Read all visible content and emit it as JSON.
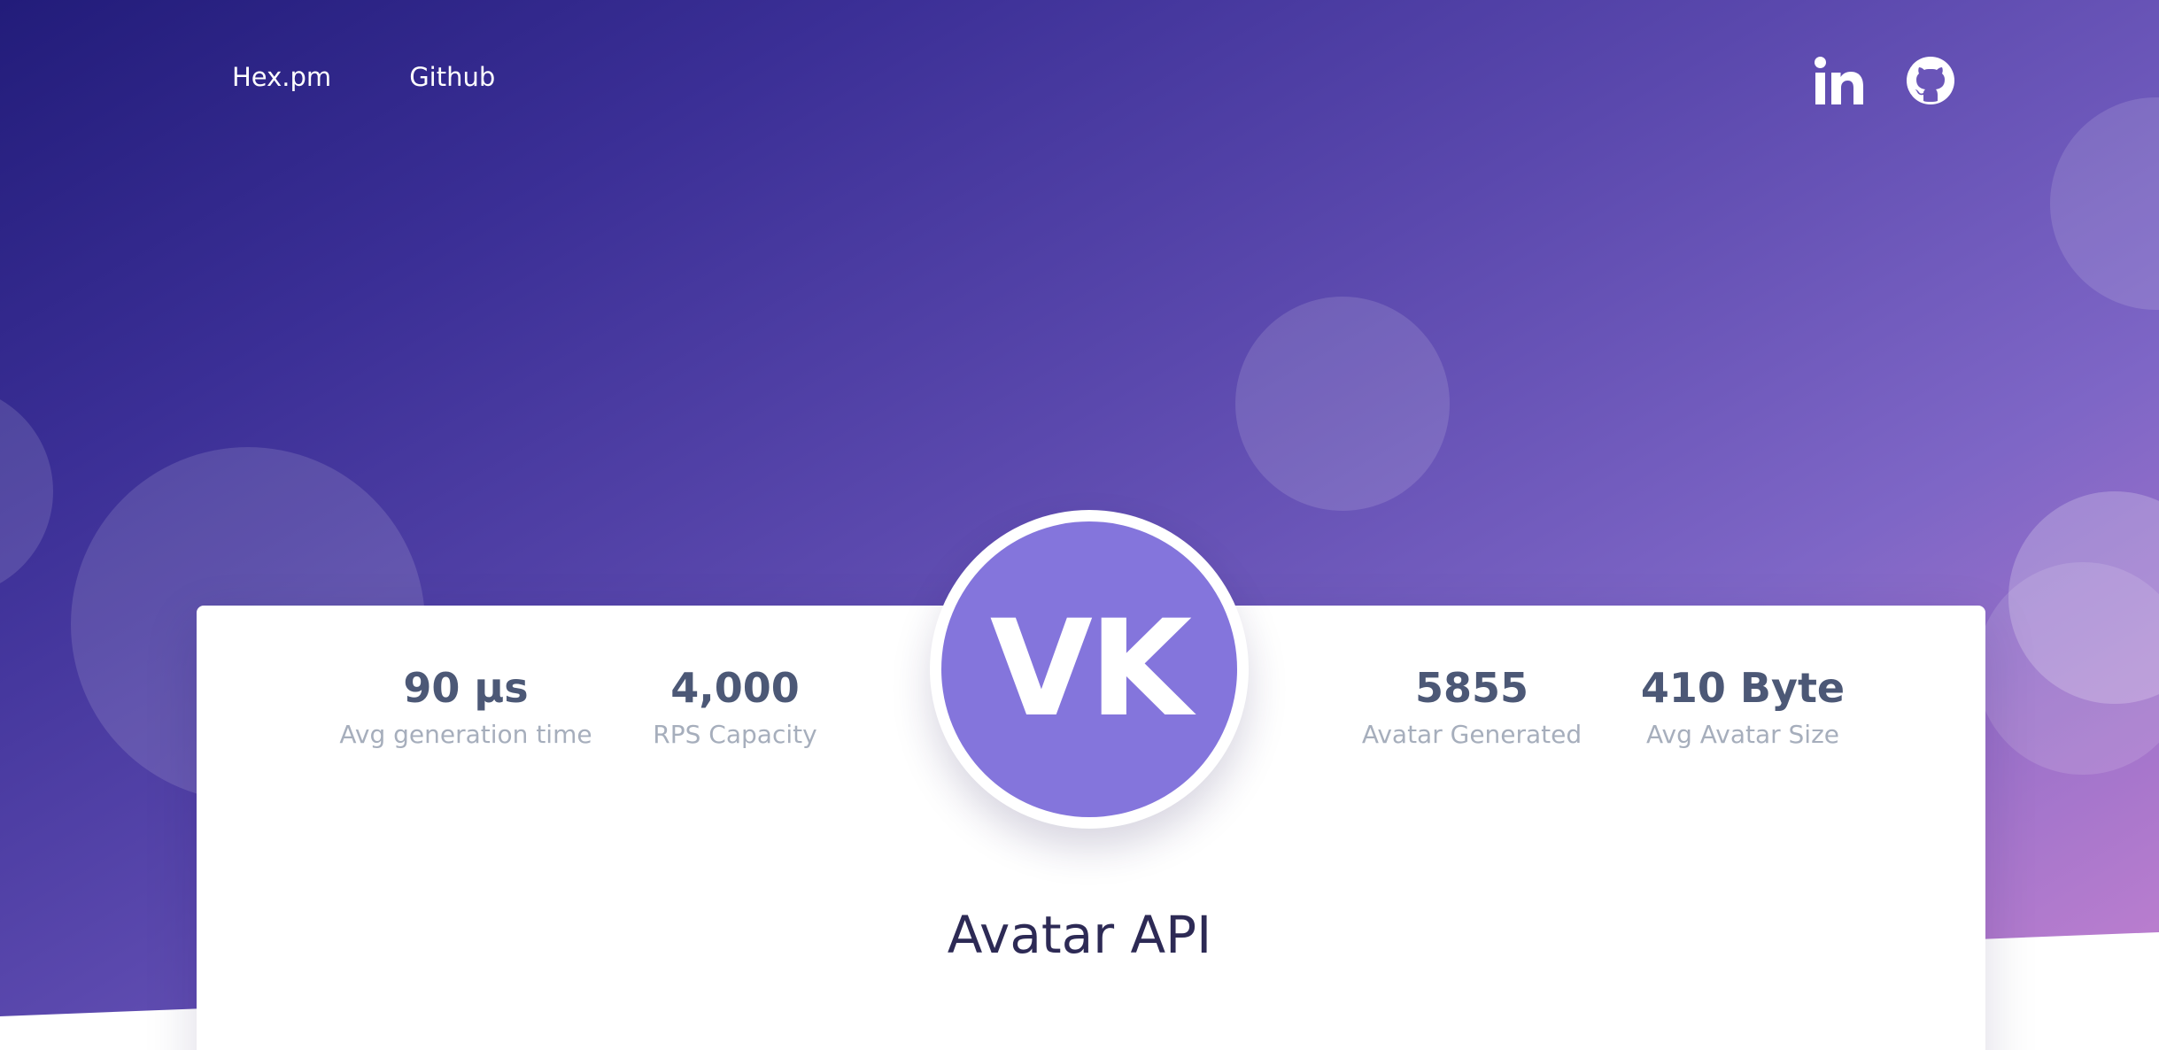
{
  "nav": {
    "links": [
      "Hex.pm",
      "Github"
    ]
  },
  "socials": {
    "icons": [
      "linkedin-icon",
      "github-icon"
    ]
  },
  "stats": {
    "left": [
      {
        "value": "90 µs",
        "label": "Avg generation time"
      },
      {
        "value": "4,000",
        "label": "RPS Capacity"
      }
    ],
    "right": [
      {
        "value": "5855",
        "label": "Avatar Generated"
      },
      {
        "value": "410 Byte",
        "label": "Avg Avatar Size"
      }
    ]
  },
  "avatar": {
    "initials": "VK",
    "color": "#8475dc"
  },
  "title": "Avatar API",
  "colors": {
    "gradient_start": "#221c7a",
    "gradient_end": "#c582d0",
    "stat_value": "#4c5876",
    "stat_label": "#a6aebc",
    "title": "#2d2a55"
  }
}
